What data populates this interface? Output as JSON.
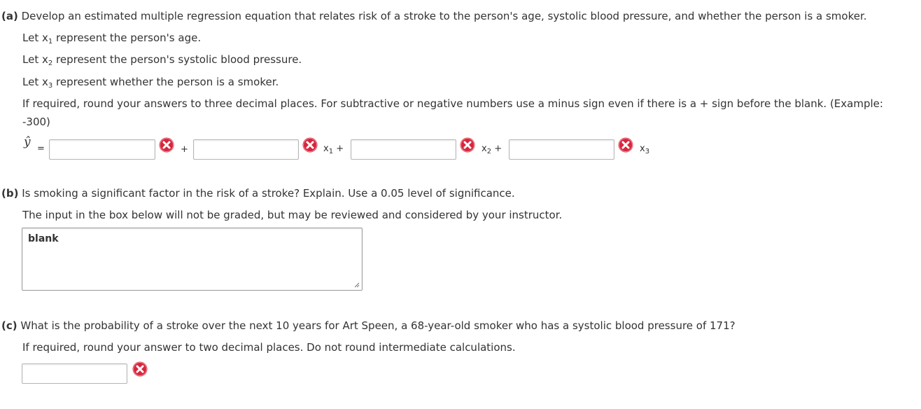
{
  "part_a": {
    "label": "(a)",
    "question": "Develop an estimated multiple regression equation that relates risk of a stroke to the person's age, systolic blood pressure, and whether the person is a smoker.",
    "let_prefix": "Let",
    "x1_desc": "represent the person's age.",
    "x2_desc": "represent the person's systolic blood pressure.",
    "x3_desc": "represent whether the person is a smoker.",
    "instructions_line1": "If required, round your answers to three decimal places. For subtractive or negative numbers use a minus sign even if there is a + sign before the blank. (Example:",
    "instructions_line2": "-300)",
    "equation": {
      "lhs": "ŷ",
      "equals": "=",
      "plus": "+",
      "var_letter": "x",
      "x1_sub": "1",
      "x2_sub": "2",
      "x3_sub": "3",
      "b0_value": "",
      "b1_value": "",
      "b2_value": "",
      "b3_value": ""
    }
  },
  "part_b": {
    "label": "(b)",
    "question": "Is smoking a significant factor in the risk of a stroke? Explain. Use a 0.05 level of significance.",
    "note": "The input in the box below will not be graded, but may be reviewed and considered by your instructor.",
    "textarea_value": "blank"
  },
  "part_c": {
    "label": "(c)",
    "question": "What is the probability of a stroke over the next 10 years for Art Speen, a 68-year-old smoker who has a systolic blood pressure of 171?",
    "instructions": "If required, round your answer to two decimal places. Do not round intermediate calculations.",
    "answer_value": ""
  },
  "icons": {
    "incorrect": "incorrect-x-icon"
  },
  "colors": {
    "incorrect_red": "#d7263d",
    "text": "#333333"
  }
}
